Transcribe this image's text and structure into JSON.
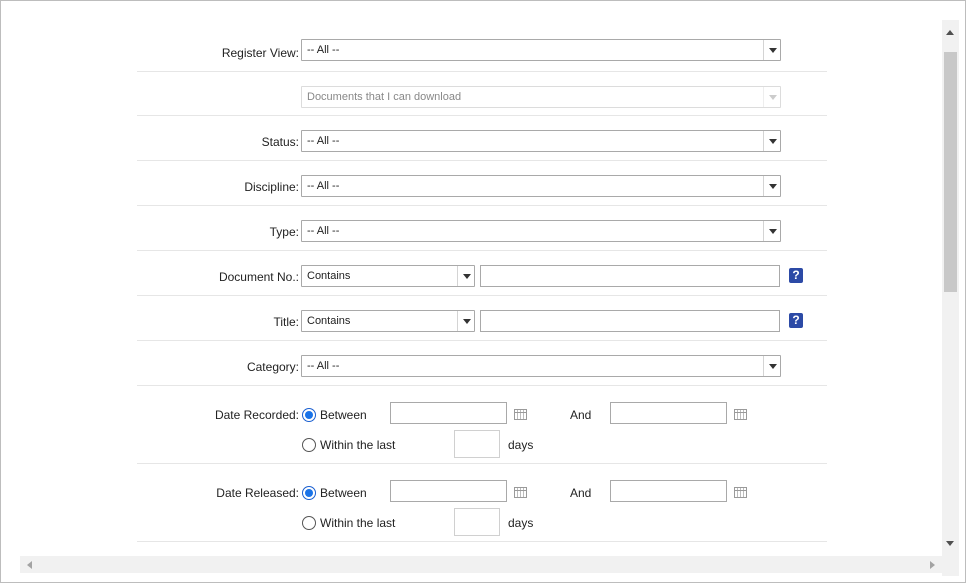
{
  "form": {
    "register_view": {
      "label": "Register View:",
      "value": "-- All --"
    },
    "download_filter": {
      "value": "Documents that I can download"
    },
    "status": {
      "label": "Status:",
      "value": "-- All --"
    },
    "discipline": {
      "label": "Discipline:",
      "value": "-- All --"
    },
    "type": {
      "label": "Type:",
      "value": "-- All --"
    },
    "document_no": {
      "label": "Document No.:",
      "operator": "Contains",
      "value": "",
      "help": "?"
    },
    "title": {
      "label": "Title:",
      "operator": "Contains",
      "value": "",
      "help": "?"
    },
    "category": {
      "label": "Category:",
      "value": "-- All --"
    },
    "date_recorded": {
      "label": "Date Recorded:",
      "between_label": "Between",
      "and_label": "And",
      "within_label": "Within the last",
      "days_label": "days",
      "selected": "between",
      "from": "",
      "to": "",
      "days": ""
    },
    "date_released": {
      "label": "Date Released:",
      "between_label": "Between",
      "and_label": "And",
      "within_label": "Within the last",
      "days_label": "days",
      "selected": "between",
      "from": "",
      "to": "",
      "days": ""
    }
  },
  "icons": {
    "calendar": "calendar-icon",
    "help": "help-icon"
  },
  "colors": {
    "help_icon_bg": "#2c4aa6",
    "radio_selected": "#1a73e8",
    "row_divider": "#e6e6e6"
  }
}
